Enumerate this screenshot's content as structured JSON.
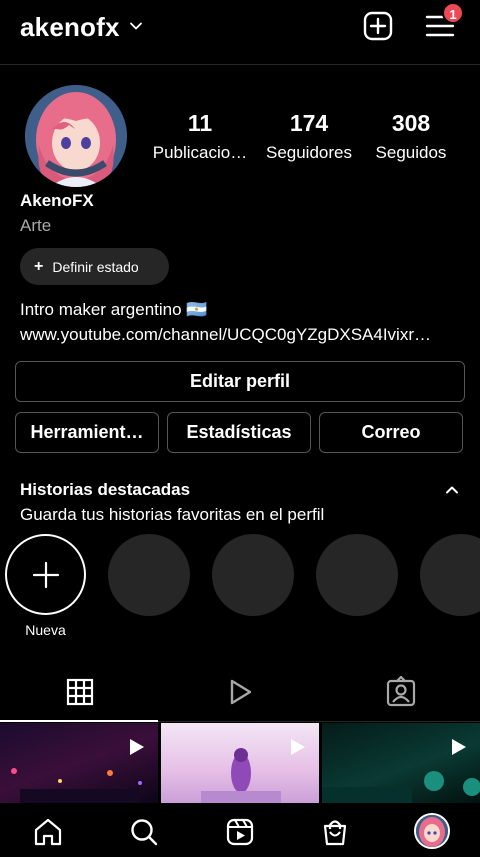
{
  "header": {
    "username": "akenofx",
    "notification_count": "1"
  },
  "profile": {
    "stats": [
      {
        "value": "11",
        "label": "Publicacio…"
      },
      {
        "value": "174",
        "label": "Seguidores"
      },
      {
        "value": "308",
        "label": "Seguidos"
      }
    ],
    "display_name": "AkenoFX",
    "category": "Arte",
    "status_button": "Definir estado",
    "bio": "Intro maker argentino 🇦🇷",
    "link": "www.youtube.com/channel/UCQC0gYZgDXSA4Ivixr…"
  },
  "actions": {
    "edit_profile": "Editar perfil",
    "tools": "Herramient…",
    "insights": "Estadísticas",
    "email": "Correo"
  },
  "highlights": {
    "title": "Historias destacadas",
    "subtitle": "Guarda tus historias favoritas en el perfil",
    "new_label": "Nueva"
  },
  "tabs": [
    "grid-icon",
    "reels-icon",
    "tagged-icon"
  ],
  "bottom_nav": [
    "home-icon",
    "search-icon",
    "reels-icon",
    "shop-icon",
    "profile-avatar"
  ],
  "colors": {
    "background": "#000000",
    "badge": "#ed4956",
    "pill": "#262626",
    "muted_text": "#a8a8a8"
  }
}
